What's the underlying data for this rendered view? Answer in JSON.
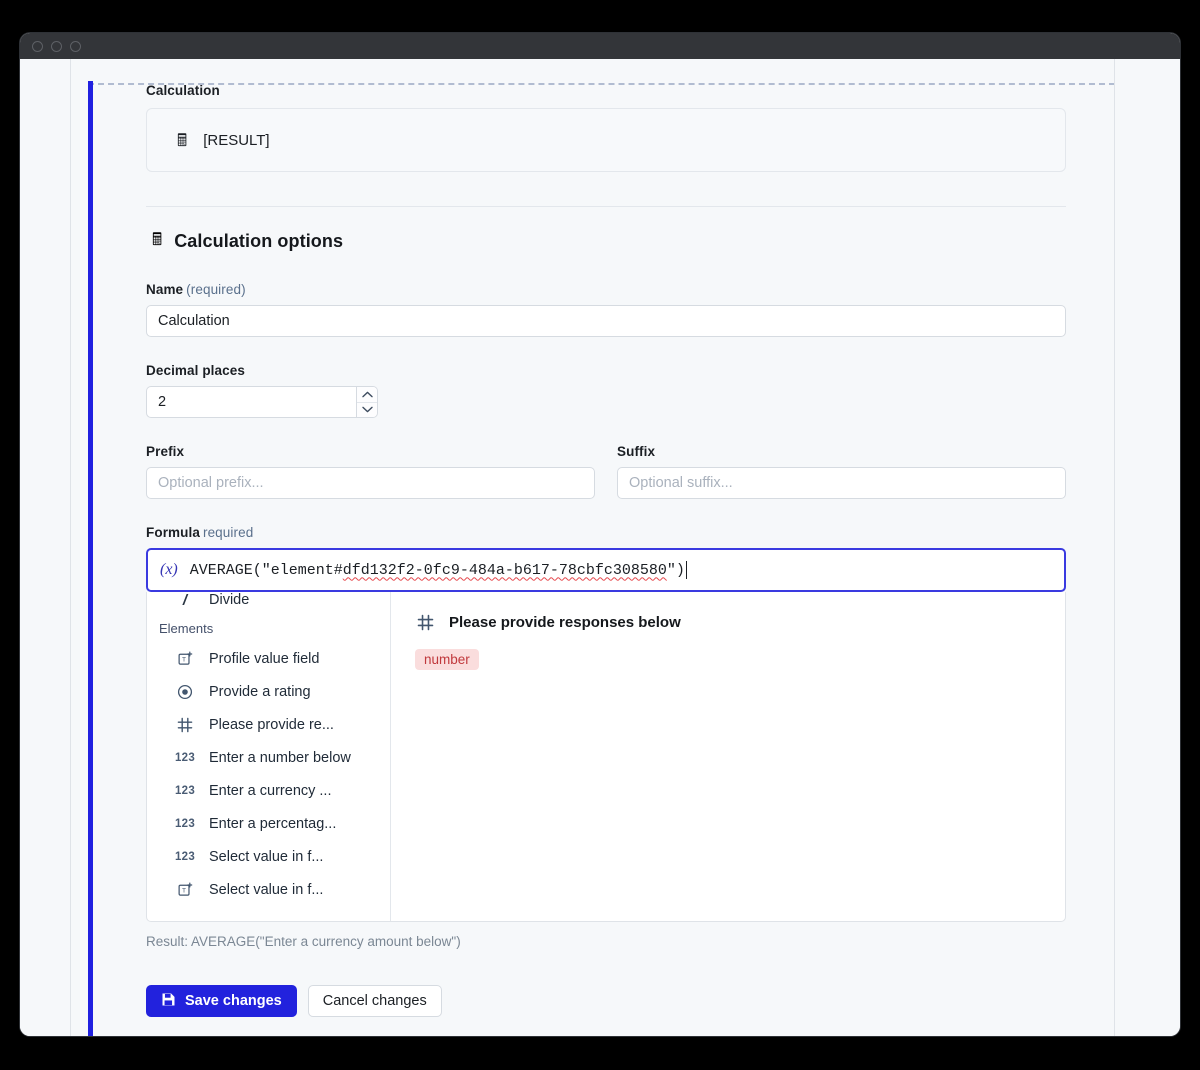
{
  "window": {
    "traffic_lights": [
      "close",
      "minimize",
      "maximize"
    ]
  },
  "preview": {
    "label": "Calculation",
    "icon": "calculator-icon",
    "result_placeholder": "[RESULT]"
  },
  "section": {
    "icon": "calculator-icon",
    "title": "Calculation options"
  },
  "fields": {
    "name": {
      "label": "Name",
      "required_note": "(required)",
      "value": "Calculation",
      "placeholder": ""
    },
    "decimal_places": {
      "label": "Decimal places",
      "value": "2",
      "increment_icon": "chevron-up-icon",
      "decrement_icon": "chevron-down-icon"
    },
    "prefix": {
      "label": "Prefix",
      "value": "",
      "placeholder": "Optional prefix..."
    },
    "suffix": {
      "label": "Suffix",
      "value": "",
      "placeholder": "Optional suffix..."
    },
    "formula": {
      "label": "Formula",
      "required_note": "required",
      "fx_icon": "(x)",
      "prefix_text": "AVERAGE(\"element#",
      "token_text": "dfd132f2-0fc9-484a-b617-78cbfc308580",
      "suffix_text": "\")"
    }
  },
  "autocomplete": {
    "partial_item": {
      "icon": "divide-icon",
      "glyph": "/",
      "label": "Divide"
    },
    "group_label": "Elements",
    "items": [
      {
        "icon": "text-field-icon",
        "glyph": "T",
        "label": "Profile value field"
      },
      {
        "icon": "radio-icon",
        "glyph": "◉",
        "label": "Provide a rating"
      },
      {
        "icon": "grid-icon",
        "glyph": "#",
        "label": "Please provide re..."
      },
      {
        "icon": "number-icon",
        "glyph": "123",
        "label": "Enter a number below"
      },
      {
        "icon": "number-icon",
        "glyph": "123",
        "label": "Enter a currency ..."
      },
      {
        "icon": "number-icon",
        "glyph": "123",
        "label": "Enter a percentag..."
      },
      {
        "icon": "number-icon",
        "glyph": "123",
        "label": "Select value in f..."
      },
      {
        "icon": "text-field-icon",
        "glyph": "T",
        "label": "Select value in f..."
      }
    ],
    "detail": {
      "icon": "grid-icon",
      "title": "Please provide responses below",
      "badge": "number"
    }
  },
  "result_hint": "Result: AVERAGE(\"Enter a currency amount below\")",
  "actions": {
    "save": {
      "label": "Save changes",
      "icon": "save-icon"
    },
    "cancel": {
      "label": "Cancel changes"
    }
  },
  "colors": {
    "accent": "#2222dd",
    "focus_border": "#3a3ae0",
    "badge_bg": "#fadddd",
    "badge_text": "#c0383c",
    "error_underline": "#e5484d"
  }
}
